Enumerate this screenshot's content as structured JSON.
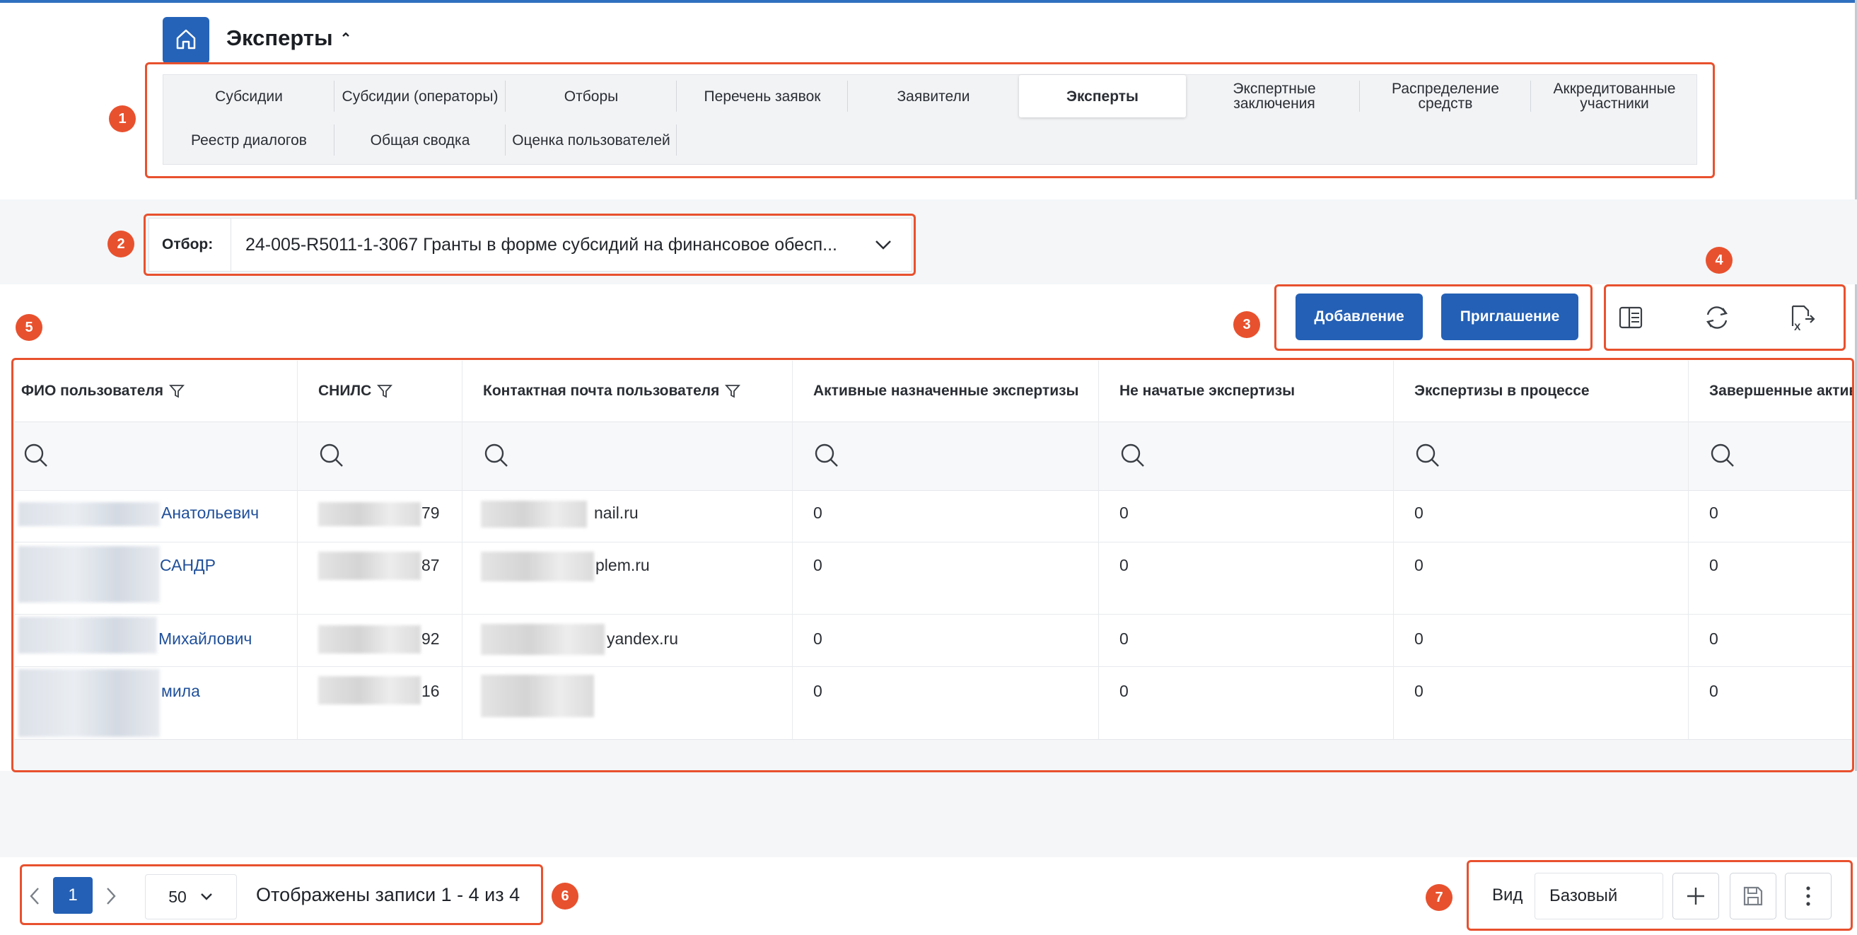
{
  "header": {
    "title": "Эксперты"
  },
  "nav_tabs": [
    {
      "label": "Субсидии"
    },
    {
      "label": "Субсидии (операторы)"
    },
    {
      "label": "Отборы"
    },
    {
      "label": "Перечень заявок"
    },
    {
      "label": "Заявители"
    },
    {
      "label": "Эксперты",
      "active": true
    },
    {
      "label": "Экспертные\nзаключения"
    },
    {
      "label": "Распределение\nсредств"
    },
    {
      "label": "Аккредитованные\nучастники"
    },
    {
      "label": "Реестр диалогов"
    },
    {
      "label": "Общая сводка"
    },
    {
      "label": "Оценка пользователей"
    }
  ],
  "filter": {
    "label": "Отбор:",
    "value": "24-005-R5011-1-3067 Гранты в форме субсидий на финансовое обесп..."
  },
  "actions": {
    "add_label": "Добавление",
    "invite_label": "Приглашение"
  },
  "toolbar_icons": [
    "columns-icon",
    "refresh-icon",
    "excel-export-icon"
  ],
  "table": {
    "columns": [
      {
        "label": "ФИО пользователя",
        "filter": true
      },
      {
        "label": "СНИЛС",
        "filter": true
      },
      {
        "label": "Контактная почта пользователя",
        "filter": true
      },
      {
        "label": "Активные назначенные экспертизы"
      },
      {
        "label": "Не начатые экспертизы"
      },
      {
        "label": "Экспертизы в процессе"
      },
      {
        "label": "Завершенные актив"
      }
    ],
    "rows": [
      {
        "name": "Анатольевич",
        "snils": "79",
        "email": "nail.ru",
        "active": "0",
        "not_started": "0",
        "in_progress": "0",
        "completed": "0"
      },
      {
        "name": "САНДР",
        "snils": "87",
        "email": "plem.ru",
        "active": "0",
        "not_started": "0",
        "in_progress": "0",
        "completed": "0"
      },
      {
        "name": "Михайлович",
        "snils": "92",
        "email": "yandex.ru",
        "active": "0",
        "not_started": "0",
        "in_progress": "0",
        "completed": "0"
      },
      {
        "name": "мила",
        "snils": "16",
        "email": "",
        "active": "0",
        "not_started": "0",
        "in_progress": "0",
        "completed": "0"
      }
    ]
  },
  "pagination": {
    "current_page": "1",
    "per_page": "50",
    "records_text": "Отображены записи 1 - 4 из 4"
  },
  "view": {
    "label": "Вид",
    "selected": "Базовый"
  },
  "annotations": [
    "1",
    "2",
    "3",
    "4",
    "5",
    "6",
    "7"
  ],
  "colors": {
    "primary": "#2460b5",
    "annotation": "#e8512e",
    "link": "#1f4f9a"
  }
}
